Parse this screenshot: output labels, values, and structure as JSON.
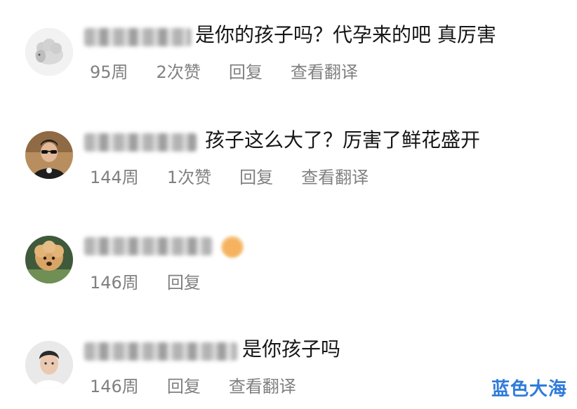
{
  "comments": [
    {
      "text": "是你的孩子吗？代孕来的吧 真厉害",
      "time": "95周",
      "likes": "2次赞",
      "reply": "回复",
      "translate": "查看翻译"
    },
    {
      "text": "孩子这么大了？厉害了鲜花盛开",
      "time": "144周",
      "likes": "1次赞",
      "reply": "回复",
      "translate": "查看翻译"
    },
    {
      "text": "",
      "time": "146周",
      "reply": "回复"
    },
    {
      "text": "是你孩子吗",
      "time": "146周",
      "reply": "回复",
      "translate": "查看翻译"
    }
  ],
  "watermark": "蓝色大海"
}
